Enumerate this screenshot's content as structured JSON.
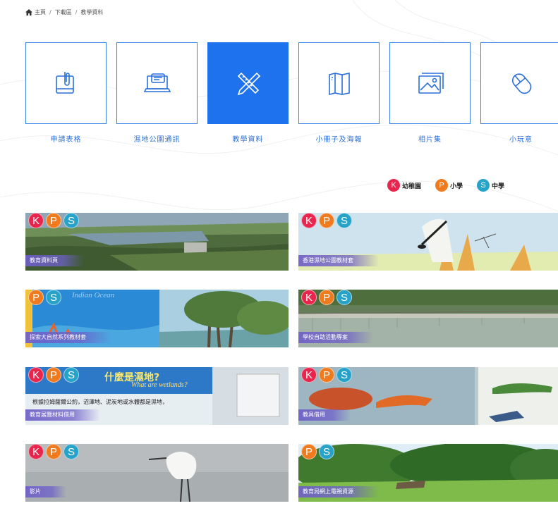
{
  "breadcrumb": [
    "主頁",
    "下載區",
    "教學資料"
  ],
  "categories": [
    {
      "label": "申請表格",
      "icon": "clipboard-icon",
      "active": false
    },
    {
      "label": "濕地公園通訊",
      "icon": "laptop-chat-icon",
      "active": false
    },
    {
      "label": "教學資料",
      "icon": "ruler-pencil-icon",
      "active": true
    },
    {
      "label": "小冊子及海報",
      "icon": "map-icon",
      "active": false
    },
    {
      "label": "相片集",
      "icon": "photo-icon",
      "active": false
    },
    {
      "label": "小玩意",
      "icon": "mouse-icon",
      "active": false
    }
  ],
  "legend": [
    {
      "letter": "K",
      "label": "幼稚園",
      "color": "#e8264d"
    },
    {
      "letter": "P",
      "label": "小學",
      "color": "#f07a1e"
    },
    {
      "letter": "S",
      "label": "中學",
      "color": "#27a3c9"
    }
  ],
  "cards": [
    {
      "caption": "教育資料頁",
      "badges": [
        "K",
        "P",
        "S"
      ]
    },
    {
      "caption": "香港濕地公園教材套",
      "badges": [
        "K",
        "P",
        "S"
      ]
    },
    {
      "caption": "探索大自然系列教材套",
      "badges": [
        "P",
        "S"
      ],
      "overlay": "Indian Ocean"
    },
    {
      "caption": "學校自助活動專案",
      "badges": [
        "K",
        "P",
        "S"
      ]
    },
    {
      "caption": "教育展覽材料借用",
      "badges": [
        "K",
        "P",
        "S"
      ],
      "overlay": "什麼是濕地?",
      "overlay_sub": "What are wetlands?",
      "overlay_body": "根據拉姆薩爾公約，沼澤地、泥炭地或水體都是濕地，"
    },
    {
      "caption": "教具借用",
      "badges": [
        "K",
        "P",
        "S"
      ]
    },
    {
      "caption": "影片",
      "badges": [
        "K",
        "P",
        "S"
      ]
    },
    {
      "caption": "教育局網上電視資源",
      "badges": [
        "P",
        "S"
      ]
    }
  ],
  "colors": {
    "accent": "#1f72ee",
    "K": "#e8264d",
    "P": "#f07a1e",
    "S": "#27a3c9"
  }
}
